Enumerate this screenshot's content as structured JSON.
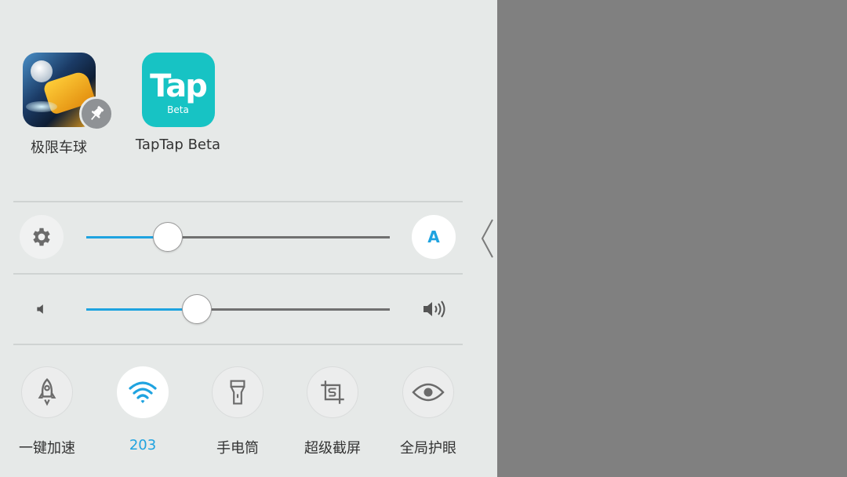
{
  "recent_apps": [
    {
      "label": "极限车球",
      "pinned": true,
      "icon": "game-app-icon"
    },
    {
      "label": "TapTap Beta",
      "icon_text": "Tap",
      "icon_subtext": "Beta",
      "icon_color": "#17c3c4"
    }
  ],
  "brightness": {
    "level": 0.27,
    "settings_icon": "gear-icon",
    "auto_label": "A",
    "auto_enabled": true
  },
  "volume": {
    "level": 0.365,
    "low_icon": "speaker-low-icon",
    "high_icon": "speaker-high-icon"
  },
  "toggles": [
    {
      "label": "一键加速",
      "icon": "rocket-icon",
      "active": false
    },
    {
      "label": "203",
      "icon": "wifi-icon",
      "active": true
    },
    {
      "label": "手电筒",
      "icon": "flashlight-icon",
      "active": false
    },
    {
      "label": "超级截屏",
      "icon": "screenshot-icon",
      "active": false
    },
    {
      "label": "全局护眼",
      "icon": "eye-icon",
      "active": false
    }
  ],
  "colors": {
    "accent": "#1fa3e0",
    "panel_bg": "#e6e9e8",
    "overlay": "#808080",
    "icon_gray": "#6b6b6b"
  }
}
